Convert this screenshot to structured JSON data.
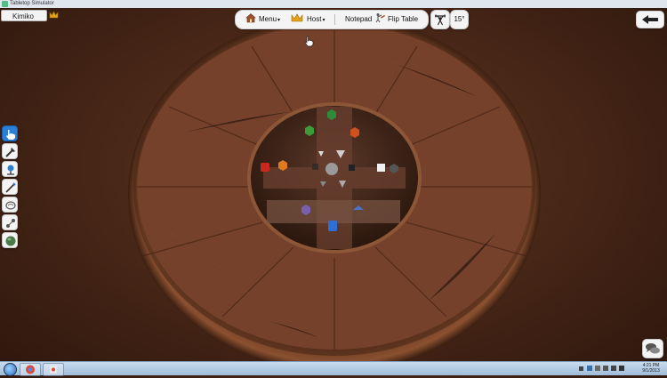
{
  "window": {
    "title": "Tabletop Simulator"
  },
  "player": {
    "name": "Kimiko",
    "host_icon": "crown-icon",
    "color": "#3cb371"
  },
  "topbar": {
    "menu_label": "Menu",
    "host_label": "Host",
    "notepad_label": "Notepad",
    "flip_label": "Flip Table",
    "rotation_label": "15°"
  },
  "tools": [
    {
      "name": "grab-tool",
      "icon": "hand-icon",
      "active": true
    },
    {
      "name": "flick-tool",
      "icon": "flick-icon",
      "active": false
    },
    {
      "name": "line-tool",
      "icon": "pin-icon",
      "active": false
    },
    {
      "name": "pen-tool",
      "icon": "pen-icon",
      "active": false
    },
    {
      "name": "zoom-tool",
      "icon": "magnifier-icon",
      "active": false
    },
    {
      "name": "joint-tool",
      "icon": "joint-icon",
      "active": false
    },
    {
      "name": "gizmo-tool",
      "icon": "sphere-icon",
      "active": false
    }
  ],
  "colors": {
    "wood_light": "#7a4429",
    "wood_dark": "#4f2a18",
    "accent": "#2b7fd6"
  },
  "taskbar": {
    "time": "4:21 PM",
    "date": "9/1/2013"
  }
}
